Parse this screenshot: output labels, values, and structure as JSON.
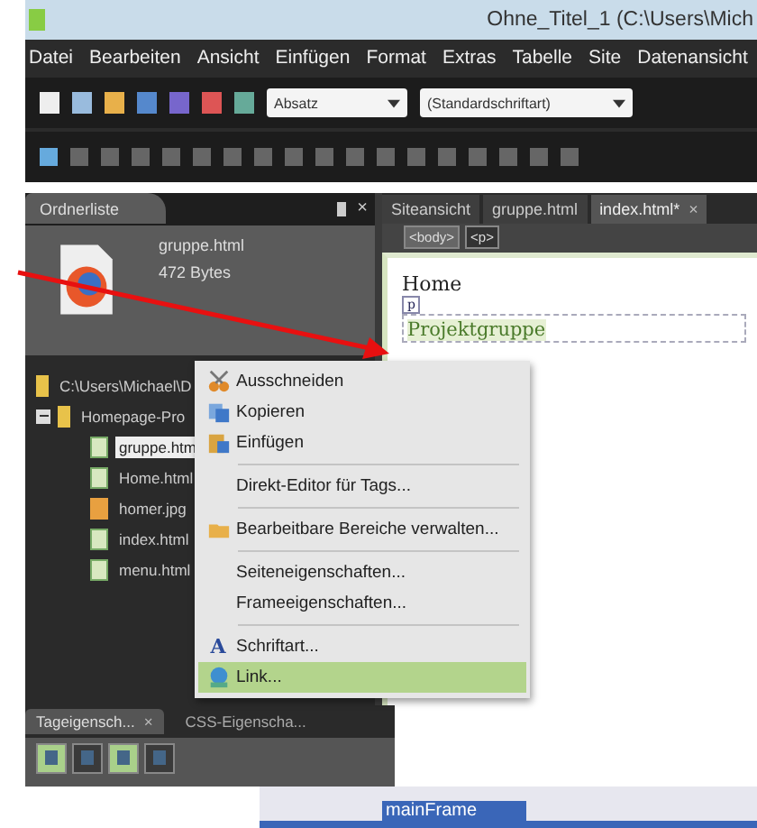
{
  "window": {
    "title": "Ohne_Titel_1 (C:\\Users\\Mich"
  },
  "menu": [
    "Datei",
    "Bearbeiten",
    "Ansicht",
    "Einfügen",
    "Format",
    "Extras",
    "Tabelle",
    "Site",
    "Datenansicht"
  ],
  "toolbar": {
    "paragraph_style": "Absatz",
    "font": "(Standardschriftart)"
  },
  "folder_panel": {
    "tab": "Ordnerliste",
    "close": "×",
    "file_name": "gruppe.html",
    "file_size": "472 Bytes",
    "root": "C:\\Users\\Michael\\D",
    "folder": {
      "label": "Homepage-Pro",
      "expanded": true
    },
    "files": [
      {
        "label": "gruppe.htm",
        "kind": "page",
        "selected": true
      },
      {
        "label": "Home.html",
        "kind": "page",
        "selected": false
      },
      {
        "label": "homer.jpg",
        "kind": "image",
        "selected": false
      },
      {
        "label": "index.html",
        "kind": "page",
        "selected": false
      },
      {
        "label": "menu.html",
        "kind": "page",
        "selected": false
      }
    ]
  },
  "editor": {
    "tabs": [
      {
        "label": "Siteansicht",
        "selected": false
      },
      {
        "label": "gruppe.html",
        "selected": false
      },
      {
        "label": "index.html*",
        "selected": true,
        "close": "×"
      }
    ],
    "breadcrumb": [
      {
        "label": "<body>",
        "selected": false
      },
      {
        "label": "<p>",
        "selected": true
      }
    ],
    "heading": "Home",
    "tag_marker": "p",
    "selected_text": "Projektgruppe"
  },
  "context_menu": [
    {
      "kind": "item",
      "label": "Ausschneiden",
      "selected": false
    },
    {
      "kind": "item",
      "label": "Kopieren",
      "selected": false
    },
    {
      "kind": "item",
      "label": "Einfügen",
      "selected": false
    },
    {
      "kind": "separator"
    },
    {
      "kind": "item",
      "label": "Direkt-Editor für Tags...",
      "selected": false
    },
    {
      "kind": "separator"
    },
    {
      "kind": "item",
      "label": "Bearbeitbare Bereiche verwalten...",
      "selected": false
    },
    {
      "kind": "separator"
    },
    {
      "kind": "item",
      "label": "Seiteneigenschaften...",
      "selected": false
    },
    {
      "kind": "item",
      "label": "Frameeigenschaften...",
      "selected": false
    },
    {
      "kind": "separator"
    },
    {
      "kind": "item",
      "glyph": "A",
      "label": "Schriftart...",
      "selected": false
    },
    {
      "kind": "item",
      "label": "Link...",
      "selected": true
    }
  ],
  "bottom_panel": {
    "tabs": [
      {
        "label": "Tageigensch...",
        "selected": true,
        "close": "×"
      },
      {
        "label": "CSS-Eigenscha...",
        "selected": false
      }
    ],
    "buttons": [
      {
        "selected": true
      },
      {
        "selected": false
      },
      {
        "selected": true
      },
      {
        "selected": false
      }
    ]
  },
  "frame_list": {
    "item": "mainFrame",
    "selected": true
  }
}
